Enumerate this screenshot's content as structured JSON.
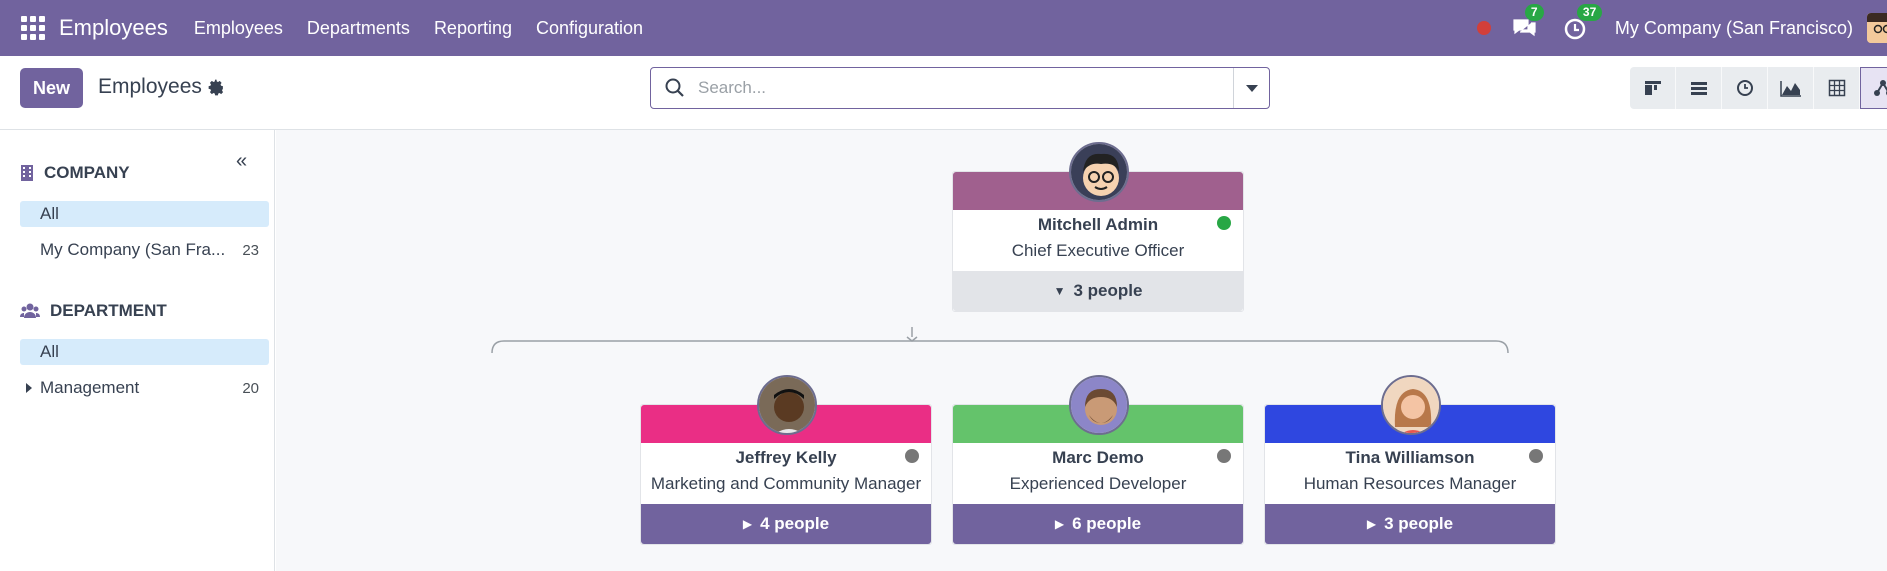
{
  "navbar": {
    "app_name": "Employees",
    "menu": [
      "Employees",
      "Departments",
      "Reporting",
      "Configuration"
    ],
    "messages_badge": "7",
    "activities_badge": "37",
    "company": "My Company (San Francisco)"
  },
  "control_panel": {
    "new_label": "New",
    "title": "Employees",
    "search_placeholder": "Search..."
  },
  "sidebar": {
    "company_header": "COMPANY",
    "company_items": [
      {
        "label": "All",
        "count": ""
      },
      {
        "label": "My Company (San Fra...",
        "count": "23"
      }
    ],
    "department_header": "DEPARTMENT",
    "department_items": [
      {
        "label": "All",
        "count": ""
      },
      {
        "label": "Management",
        "count": "20"
      }
    ]
  },
  "org_chart": {
    "root": {
      "name": "Mitchell Admin",
      "job": "Chief Executive Officer",
      "people": "3 people",
      "color": "#a0608e",
      "status_color": "#28a745"
    },
    "children": [
      {
        "name": "Jeffrey Kelly",
        "job": "Marketing and Community Manager",
        "people": "4 people",
        "color": "#ea2e85",
        "status_color": "#777777"
      },
      {
        "name": "Marc Demo",
        "job": "Experienced Developer",
        "people": "6 people",
        "color": "#64c36b",
        "status_color": "#777777"
      },
      {
        "name": "Tina Williamson",
        "job": "Human Resources Manager",
        "people": "3 people",
        "color": "#2f47e0",
        "status_color": "#777777"
      }
    ]
  }
}
